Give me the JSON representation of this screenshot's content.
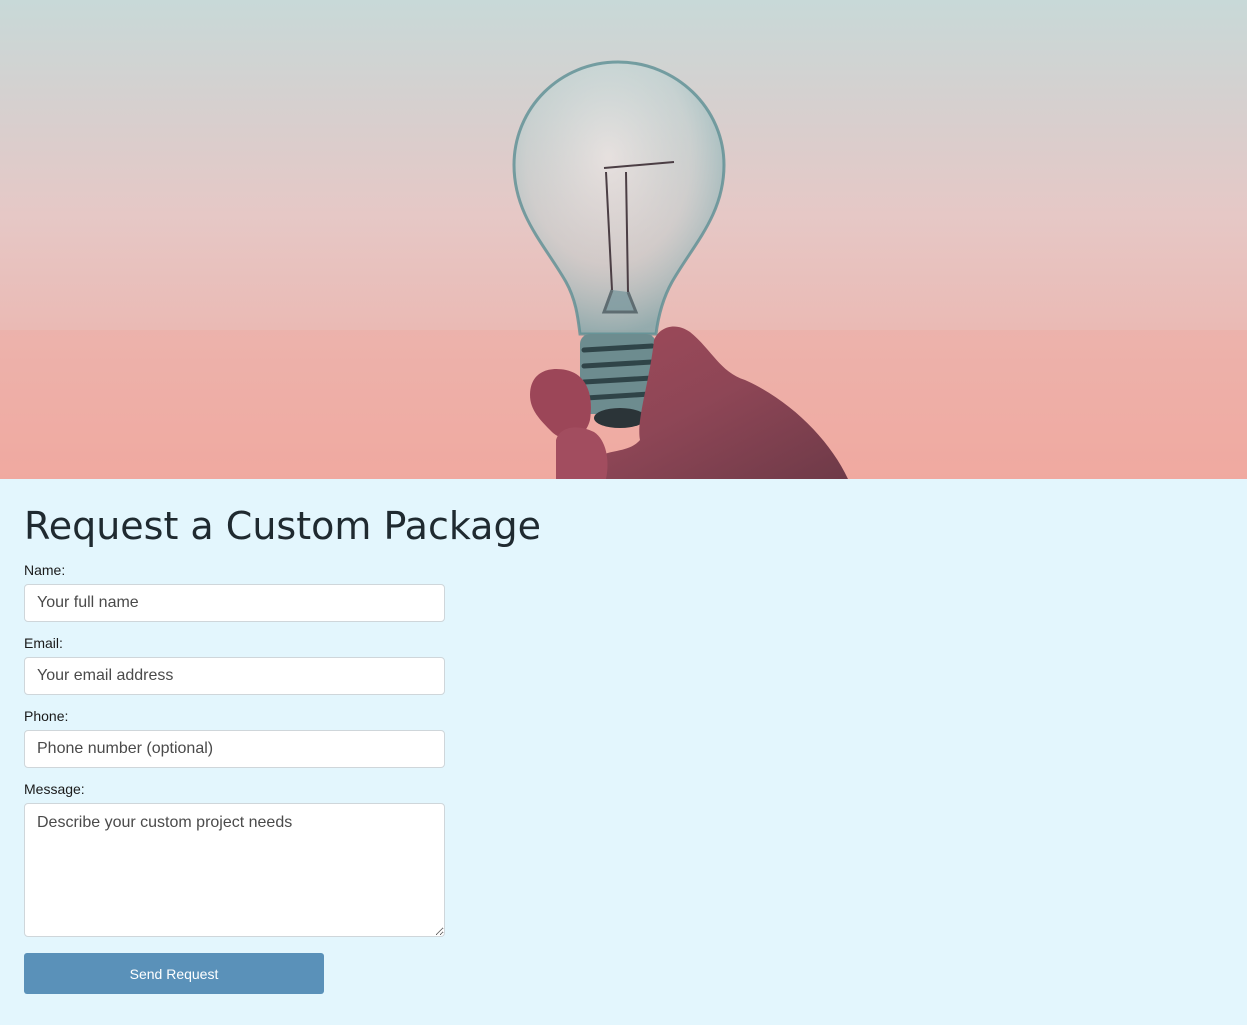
{
  "hero": {
    "image": "lightbulb-held-in-hand-photo",
    "colors": {
      "sky_top": "#c8d9d8",
      "sky_bottom": "#f0aba2"
    }
  },
  "form": {
    "title": "Request a Custom Package",
    "name": {
      "label": "Name:",
      "placeholder": "Your full name",
      "value": ""
    },
    "email": {
      "label": "Email:",
      "placeholder": "Your email address",
      "value": ""
    },
    "phone": {
      "label": "Phone:",
      "placeholder": "Phone number (optional)",
      "value": ""
    },
    "message": {
      "label": "Message:",
      "placeholder": "Describe your custom project needs",
      "value": ""
    },
    "submit_label": "Send Request"
  },
  "colors": {
    "page_background": "#e3f6fd",
    "button_background": "#5a91b9",
    "button_text": "#ffffff"
  }
}
